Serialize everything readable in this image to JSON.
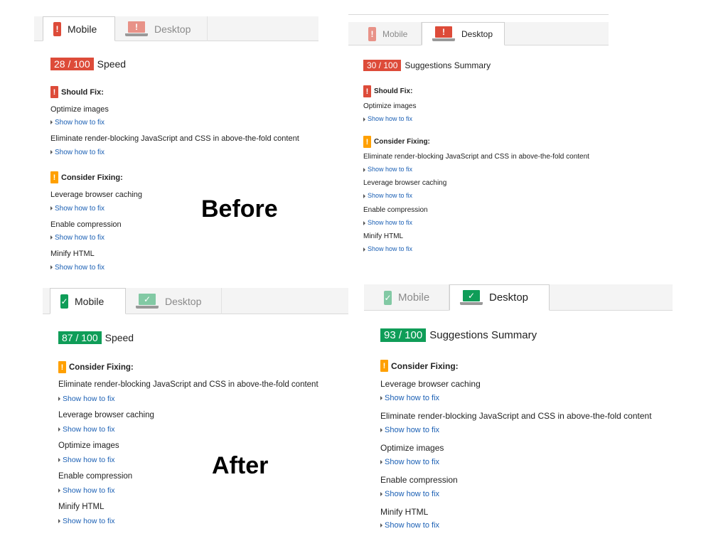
{
  "labels": {
    "before": "Before",
    "after": "After"
  },
  "tabs": {
    "mobile": "Mobile",
    "desktop": "Desktop"
  },
  "fix_link": "Show how to fix",
  "colors": {
    "score_poor": "#dd4b39",
    "score_good": "#0f9d58",
    "should_fix": "#dd4b39",
    "consider_fixing": "#ffa000",
    "link": "#1a5fb4"
  },
  "panels": {
    "before_mobile": {
      "active_tab": "Mobile",
      "score": "28 / 100",
      "score_label": "Speed",
      "should_fix": "Should Fix:",
      "consider_fixing": "Consider Fixing:",
      "should_items": [
        "Optimize images",
        "Eliminate render-blocking JavaScript and CSS in above-the-fold content"
      ],
      "consider_items": [
        "Leverage browser caching",
        "Enable compression",
        "Minify HTML"
      ]
    },
    "before_desktop": {
      "active_tab": "Desktop",
      "score": "30 / 100",
      "score_label": "Suggestions Summary",
      "should_fix": "Should Fix:",
      "consider_fixing": "Consider Fixing:",
      "should_items": [
        "Optimize images"
      ],
      "consider_items": [
        "Eliminate render-blocking JavaScript and CSS in above-the-fold content",
        "Leverage browser caching",
        "Enable compression",
        "Minify HTML"
      ]
    },
    "after_mobile": {
      "active_tab": "Mobile",
      "score": "87 / 100",
      "score_label": "Speed",
      "consider_fixing": "Consider Fixing:",
      "consider_items": [
        "Eliminate render-blocking JavaScript and CSS in above-the-fold content",
        "Leverage browser caching",
        "Optimize images",
        "Enable compression",
        "Minify HTML"
      ]
    },
    "after_desktop": {
      "active_tab": "Desktop",
      "score": "93 / 100",
      "score_label": "Suggestions Summary",
      "consider_fixing": "Consider Fixing:",
      "consider_items": [
        "Leverage browser caching",
        "Eliminate render-blocking JavaScript and CSS in above-the-fold content",
        "Optimize images",
        "Enable compression",
        "Minify HTML"
      ]
    }
  }
}
